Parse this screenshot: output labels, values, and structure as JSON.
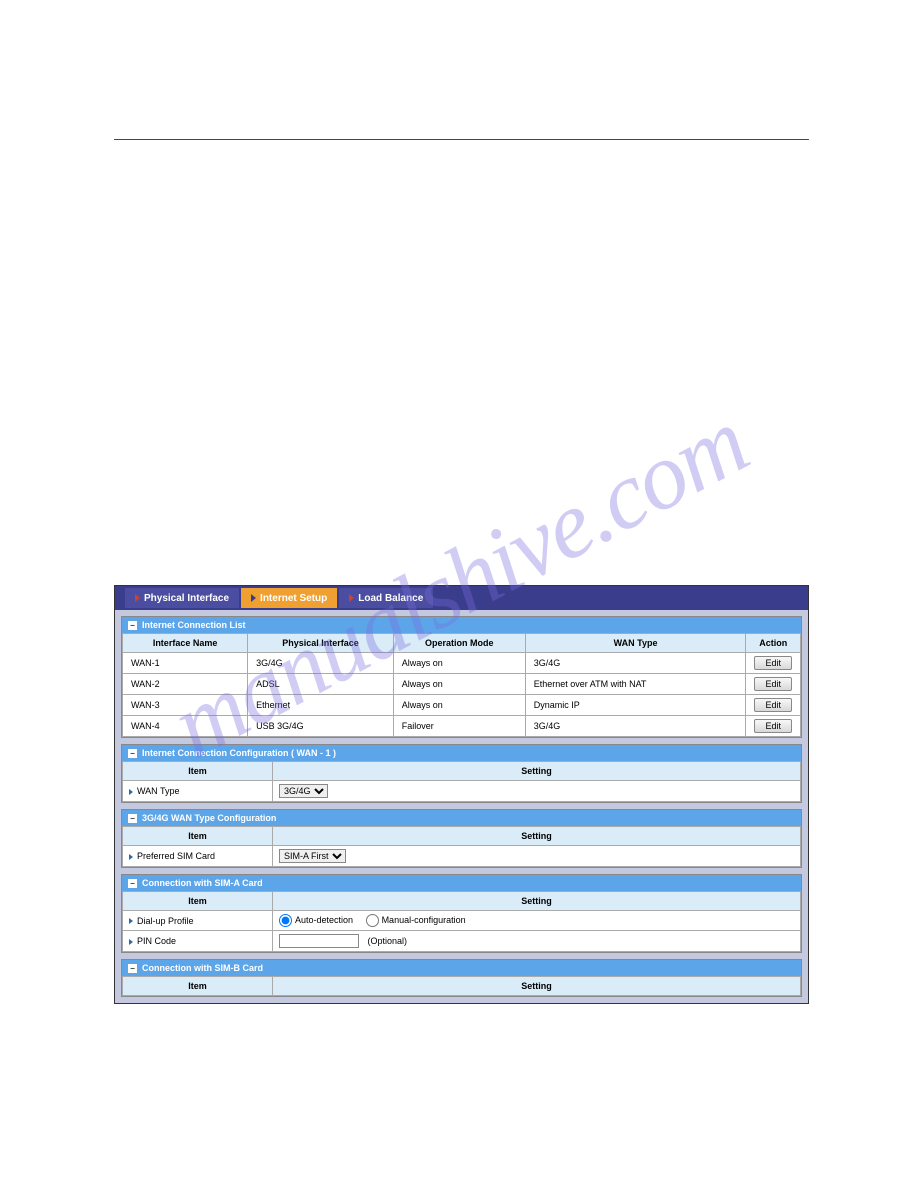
{
  "watermark": "manualshive.com",
  "tabs": {
    "physical_interface": "Physical Interface",
    "internet_setup": "Internet Setup",
    "load_balance": "Load Balance"
  },
  "sections": {
    "conn_list_title": "Internet Connection List",
    "conn_config_title": "Internet Connection Configuration ( WAN - 1 )",
    "wan_type_config_title": "3G/4G WAN Type Configuration",
    "sim_a_title": "Connection with SIM-A Card",
    "sim_b_title": "Connection with SIM-B Card"
  },
  "headers": {
    "interface_name": "Interface Name",
    "physical_interface": "Physical Interface",
    "operation_mode": "Operation Mode",
    "wan_type": "WAN Type",
    "action": "Action",
    "item": "Item",
    "setting": "Setting"
  },
  "conn_list": [
    {
      "name": "WAN-1",
      "iface": "3G/4G",
      "mode": "Always on",
      "type": "3G/4G",
      "action": "Edit"
    },
    {
      "name": "WAN-2",
      "iface": "ADSL",
      "mode": "Always on",
      "type": "Ethernet over ATM with NAT",
      "action": "Edit"
    },
    {
      "name": "WAN-3",
      "iface": "Ethernet",
      "mode": "Always on",
      "type": "Dynamic IP",
      "action": "Edit"
    },
    {
      "name": "WAN-4",
      "iface": "USB 3G/4G",
      "mode": "Failover",
      "type": "3G/4G",
      "action": "Edit"
    }
  ],
  "items": {
    "wan_type": "WAN Type",
    "preferred_sim": "Preferred SIM Card",
    "dialup_profile": "Dial-up Profile",
    "pin_code": "PIN Code"
  },
  "selects": {
    "wan_type_value": "3G/4G",
    "preferred_sim_value": "SIM-A First"
  },
  "radios": {
    "auto_detection": "Auto-detection",
    "manual_config": "Manual-configuration"
  },
  "labels": {
    "optional": "(Optional)"
  }
}
